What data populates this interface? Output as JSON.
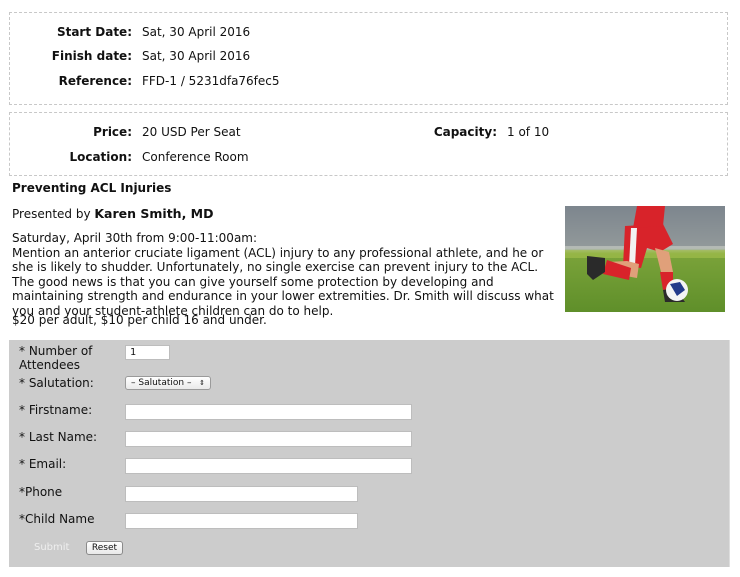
{
  "event_dates": {
    "start_date_label": "Start Date:",
    "start_date": "Sat, 30 April 2016",
    "finish_date_label": "Finish date:",
    "finish_date": "Sat, 30 April 2016",
    "reference_label": "Reference:",
    "reference": "FFD-1 / 5231dfa76fec5"
  },
  "event_info": {
    "price_label": "Price:",
    "price": "20 USD Per Seat",
    "capacity_label": "Capacity:",
    "capacity": "1 of 10",
    "location_label": "Location:",
    "location": "Conference Room"
  },
  "event": {
    "title": "Preventing ACL Injuries",
    "presented_by_prefix": "Presented by ",
    "presenter": "Karen Smith, MD",
    "schedule": "Saturday, April 30th from 9:00-11:00am:",
    "description": "Mention an anterior cruciate ligament (ACL) injury to any professional athlete, and he or she is likely to shudder. Unfortunately, no single exercise can prevent injury to the ACL. The good news is that you can give yourself some protection by developing and maintaining strength and endurance in your lower extremities. Dr. Smith will discuss what you and your student-athlete children can do to help.",
    "pricing_note": "$20 per adult, $10 per child 16 and under.",
    "image": "soccer-player-kicking-ball-photo"
  },
  "form": {
    "attendees_label_line1": "* Number of",
    "attendees_label_line2": "Attendees",
    "attendees_value": "1",
    "salutation_label": "* Salutation:",
    "salutation_selected": "– Salutation –",
    "firstname_label": "* Firstname:",
    "firstname_value": "",
    "lastname_label": "* Last Name:",
    "lastname_value": "",
    "email_label": "* Email:",
    "email_value": "",
    "phone_label": "*Phone",
    "phone_value": "",
    "child_label": "*Child Name",
    "child_value": "",
    "submit_label": "Submit",
    "reset_label": "Reset"
  },
  "colors": {
    "form_background": "#cccccc",
    "submit_text": "#efefef",
    "border_dashed": "#c8c8c8"
  }
}
